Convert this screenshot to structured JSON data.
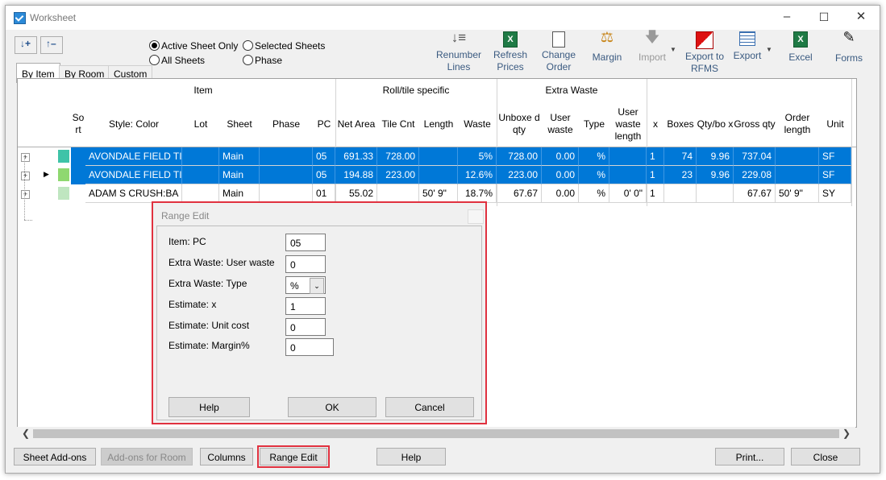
{
  "window": {
    "title": "Worksheet"
  },
  "view_options": {
    "radios": [
      {
        "label": "Active Sheet Only",
        "selected": true
      },
      {
        "label": "Selected Sheets",
        "selected": false
      },
      {
        "label": "All Sheets",
        "selected": false
      },
      {
        "label": "Phase",
        "selected": false
      }
    ]
  },
  "tabs": [
    "By Item",
    "By Room",
    "Custom"
  ],
  "toolbar": {
    "renumber": "Renumber Lines",
    "refresh": "Refresh Prices",
    "change_order": "Change Order",
    "margin": "Margin",
    "import": "Import",
    "export_rfms": "Export to RFMS",
    "export": "Export",
    "excel": "Excel",
    "forms": "Forms"
  },
  "grid": {
    "group_headers": {
      "item": "Item",
      "roll": "Roll/tile specific",
      "waste": "Extra Waste"
    },
    "columns": [
      "Sort",
      "Style: Color",
      "Lot",
      "Sheet",
      "Phase",
      "PC",
      "Net Area",
      "Tile Cnt",
      "Length",
      "Waste",
      "Unboxed qty",
      "User waste",
      "Type",
      "User waste length",
      "x",
      "Boxes",
      "Qty/box",
      "Gross qty",
      "Order length",
      "Unit"
    ],
    "column_display": [
      "So rt",
      "Style: Color",
      "Lot",
      "Sheet",
      "Phase",
      "PC",
      "Net Area",
      "Tile Cnt",
      "Length",
      "Waste",
      "Unboxe d qty",
      "User waste",
      "Type",
      "User waste length",
      "x",
      "Boxes",
      "Qty/bo x",
      "Gross qty",
      "Order length",
      "Unit"
    ],
    "rows": [
      {
        "color": "#3fc3a8",
        "style": "AVONDALE FIELD TI",
        "lot": "",
        "sheet": "Main",
        "phase": "",
        "pc": "05",
        "net": "691.33",
        "tile": "728.00",
        "length": "",
        "waste": "5%",
        "unboxed": "728.00",
        "uwaste": "0.00",
        "type": "%",
        "uwl": "",
        "x": "1",
        "boxes": "74",
        "qtybox": "9.96",
        "gross": "737.04",
        "order": "",
        "unit": "SF",
        "selected": true,
        "current": false
      },
      {
        "color": "#8fd870",
        "style": "AVONDALE FIELD TI",
        "lot": "",
        "sheet": "Main",
        "phase": "",
        "pc": "05",
        "net": "194.88",
        "tile": "223.00",
        "length": "",
        "waste": "12.6%",
        "unboxed": "223.00",
        "uwaste": "0.00",
        "type": "%",
        "uwl": "",
        "x": "1",
        "boxes": "23",
        "qtybox": "9.96",
        "gross": "229.08",
        "order": "",
        "unit": "SF",
        "selected": true,
        "current": true
      },
      {
        "color": "#bfe6c0",
        "style": "ADAM S CRUSH:BA",
        "lot": "",
        "sheet": "Main",
        "phase": "",
        "pc": "01",
        "net": "55.02",
        "tile": "",
        "length": "50' 9\"",
        "waste": "18.7%",
        "unboxed": "67.67",
        "uwaste": "0.00",
        "type": "%",
        "uwl": "0' 0\"",
        "x": "1",
        "boxes": "",
        "qtybox": "",
        "gross": "67.67",
        "order": "50' 9\"",
        "unit": "SY",
        "selected": false,
        "current": false
      }
    ]
  },
  "dialog": {
    "title": "Range Edit",
    "fields": [
      {
        "label": "Item: PC",
        "value": "05"
      },
      {
        "label": "Extra Waste: User waste",
        "value": "0"
      },
      {
        "label": "Extra Waste: Type",
        "value": "%"
      },
      {
        "label": "Estimate: x",
        "value": "1"
      },
      {
        "label": "Estimate: Unit cost",
        "value": "0"
      },
      {
        "label": "Estimate: Margin%",
        "value": "0"
      }
    ],
    "help": "Help",
    "ok": "OK",
    "cancel": "Cancel"
  },
  "footer": {
    "sheet_addons": "Sheet Add-ons",
    "addons_room": "Add-ons for Room",
    "columns": "Columns",
    "range_edit": "Range Edit",
    "help": "Help",
    "print": "Print...",
    "close": "Close"
  }
}
